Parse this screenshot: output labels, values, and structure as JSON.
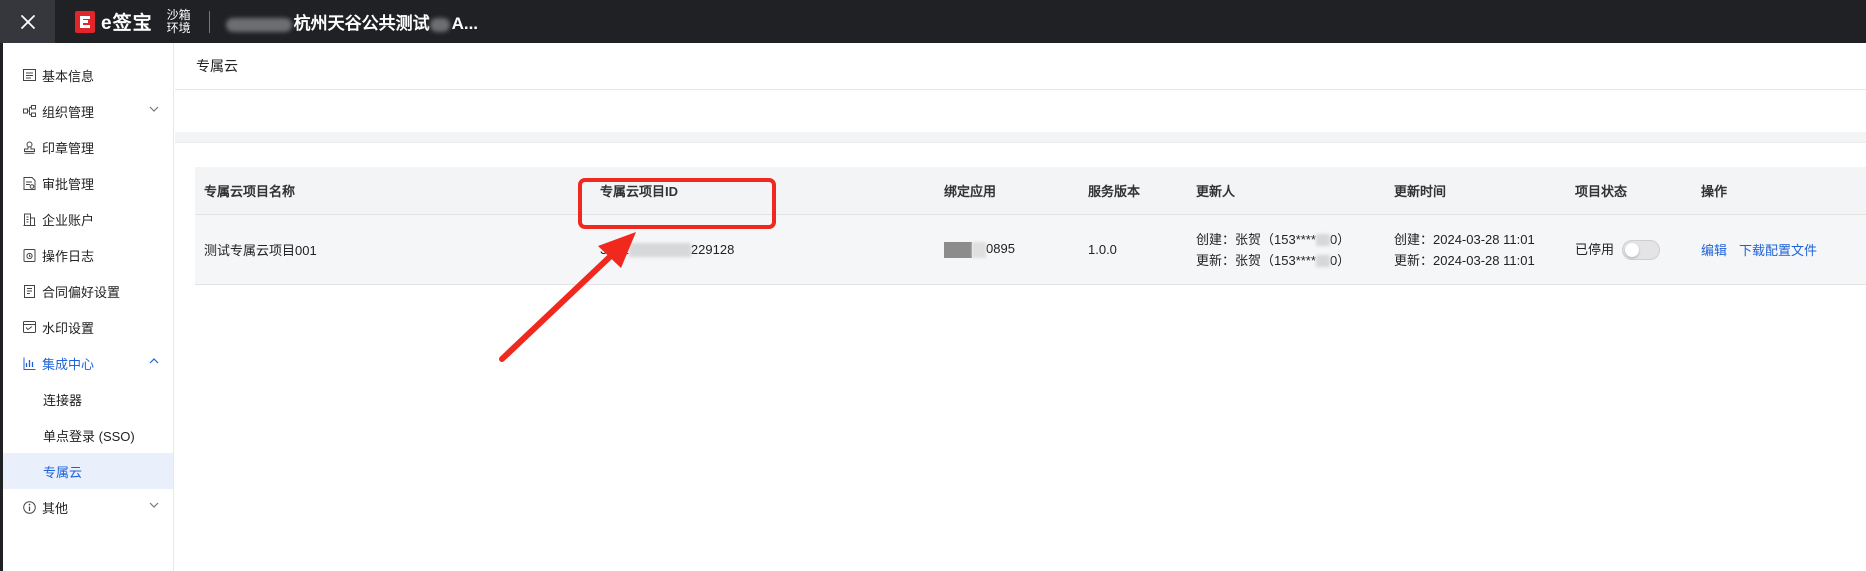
{
  "topbar": {
    "logo_text": "e签宝",
    "env_label": "沙箱环境",
    "org_name": "杭州天谷公共测试",
    "org_suffix": "A..."
  },
  "sidebar": {
    "items": [
      {
        "label": "基本信息",
        "icon": "list-icon"
      },
      {
        "label": "组织管理",
        "icon": "org-tree-icon"
      },
      {
        "label": "印章管理",
        "icon": "seal-icon"
      },
      {
        "label": "审批管理",
        "icon": "approval-icon"
      },
      {
        "label": "企业账户",
        "icon": "enterprise-icon"
      },
      {
        "label": "操作日志",
        "icon": "log-icon"
      },
      {
        "label": "合同偏好设置",
        "icon": "contract-icon"
      },
      {
        "label": "水印设置",
        "icon": "watermark-icon"
      },
      {
        "label": "集成中心",
        "icon": "integration-icon"
      },
      {
        "label": "连接器"
      },
      {
        "label": "单点登录 (SSO)"
      },
      {
        "label": "专属云"
      },
      {
        "label": "其他",
        "icon": "info-icon"
      }
    ]
  },
  "page": {
    "title": "专属云"
  },
  "table": {
    "headers": [
      "专属云项目名称",
      "专属云项目ID",
      "绑定应用",
      "服务版本",
      "更新人",
      "更新时间",
      "项目状态",
      "操作"
    ],
    "rows": [
      {
        "name": "测试专属云项目001",
        "id_prefix": "3302",
        "id_suffix": "229128",
        "app_suffix": "0895",
        "version": "1.0.0",
        "creator": "创建：张贺（153****",
        "creator_end": "0）",
        "updater": "更新：张贺（153****",
        "updater_end": "0）",
        "created_time": "创建：2024-03-28 11:01",
        "updated_time": "更新：2024-03-28 11:01",
        "status": "已停用",
        "actions": [
          "编辑",
          "下载配置文件"
        ]
      }
    ]
  },
  "colors": {
    "accent": "#1f62d8",
    "annotation_red": "#f0281e",
    "topbar": "#1f2125"
  }
}
